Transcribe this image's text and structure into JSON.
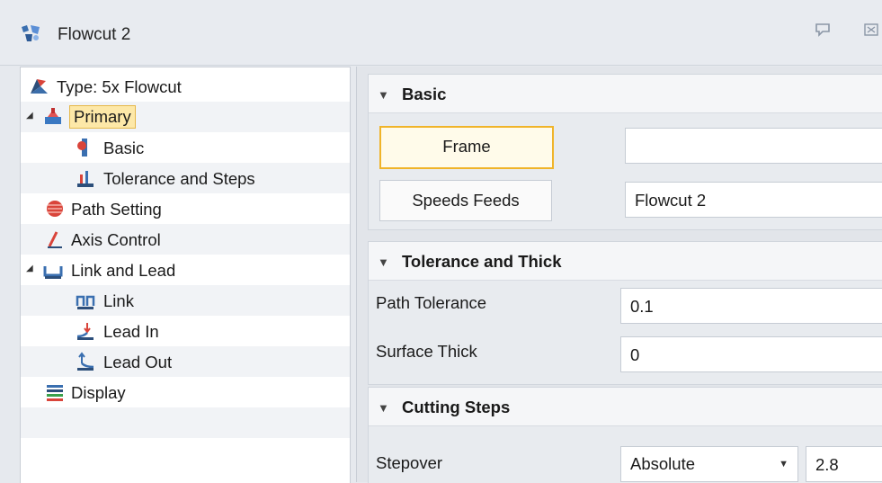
{
  "window": {
    "title": "Flowcut 2"
  },
  "tree": {
    "items": [
      {
        "label": "Type: 5x Flowcut"
      },
      {
        "label": "Primary"
      },
      {
        "label": "Basic"
      },
      {
        "label": "Tolerance and Steps"
      },
      {
        "label": "Path Setting"
      },
      {
        "label": "Axis Control"
      },
      {
        "label": "Link and Lead"
      },
      {
        "label": "Link"
      },
      {
        "label": "Lead In"
      },
      {
        "label": "Lead Out"
      },
      {
        "label": "Display"
      }
    ]
  },
  "basic": {
    "header": "Basic",
    "frame_label": "Frame",
    "frame_value": "",
    "speeds_label": "Speeds Feeds",
    "speeds_value": "Flowcut 2"
  },
  "tolerance": {
    "header": "Tolerance and Thick",
    "path_tolerance_label": "Path Tolerance",
    "path_tolerance_value": "0.1",
    "surface_thick_label": "Surface Thick",
    "surface_thick_value": "0"
  },
  "cutting": {
    "header": "Cutting Steps",
    "stepover_label": "Stepover",
    "stepover_mode": "Absolute",
    "stepover_value": "2.8"
  },
  "colors": {
    "selection": "#fde8a8",
    "focus_border": "#f0b429"
  }
}
